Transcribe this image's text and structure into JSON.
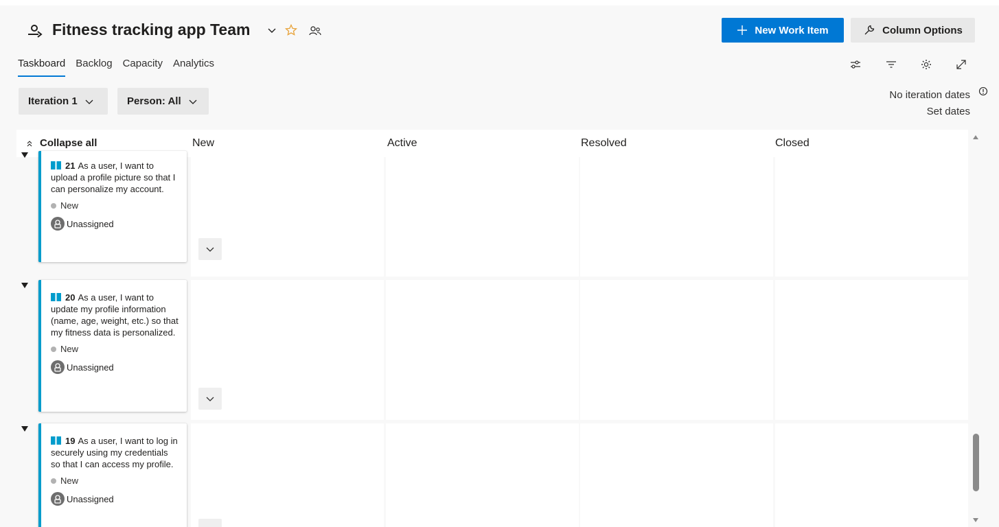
{
  "header": {
    "team_name": "Fitness tracking app Team",
    "new_work_item_label": "New Work Item",
    "column_options_label": "Column Options"
  },
  "tabs": [
    {
      "label": "Taskboard",
      "active": true
    },
    {
      "label": "Backlog",
      "active": false
    },
    {
      "label": "Capacity",
      "active": false
    },
    {
      "label": "Analytics",
      "active": false
    }
  ],
  "toolbar_icons": [
    "settings-sliders-icon",
    "filter-icon",
    "gear-icon",
    "expand-icon"
  ],
  "filters": {
    "iteration": "Iteration 1",
    "person": "Person: All"
  },
  "iteration_dates": {
    "status": "No iteration dates",
    "action": "Set dates"
  },
  "board": {
    "collapse_all_label": "Collapse all",
    "columns": [
      "New",
      "Active",
      "Resolved",
      "Closed"
    ],
    "rows": [
      {
        "id": "21",
        "title": "As a user, I want to upload a profile picture so that I can personalize my account.",
        "state": "New",
        "assignee": "Unassigned"
      },
      {
        "id": "20",
        "title": "As a user, I want to update my profile information (name, age, weight, etc.) so that my fitness data is personalized.",
        "state": "New",
        "assignee": "Unassigned"
      },
      {
        "id": "19",
        "title": "As a user, I want to log in securely using my credentials so that I can access my profile.",
        "state": "New",
        "assignee": "Unassigned"
      }
    ]
  },
  "colors": {
    "primary": "#0078d4",
    "card_accent": "#009ccc",
    "star": "#e8a33a"
  }
}
